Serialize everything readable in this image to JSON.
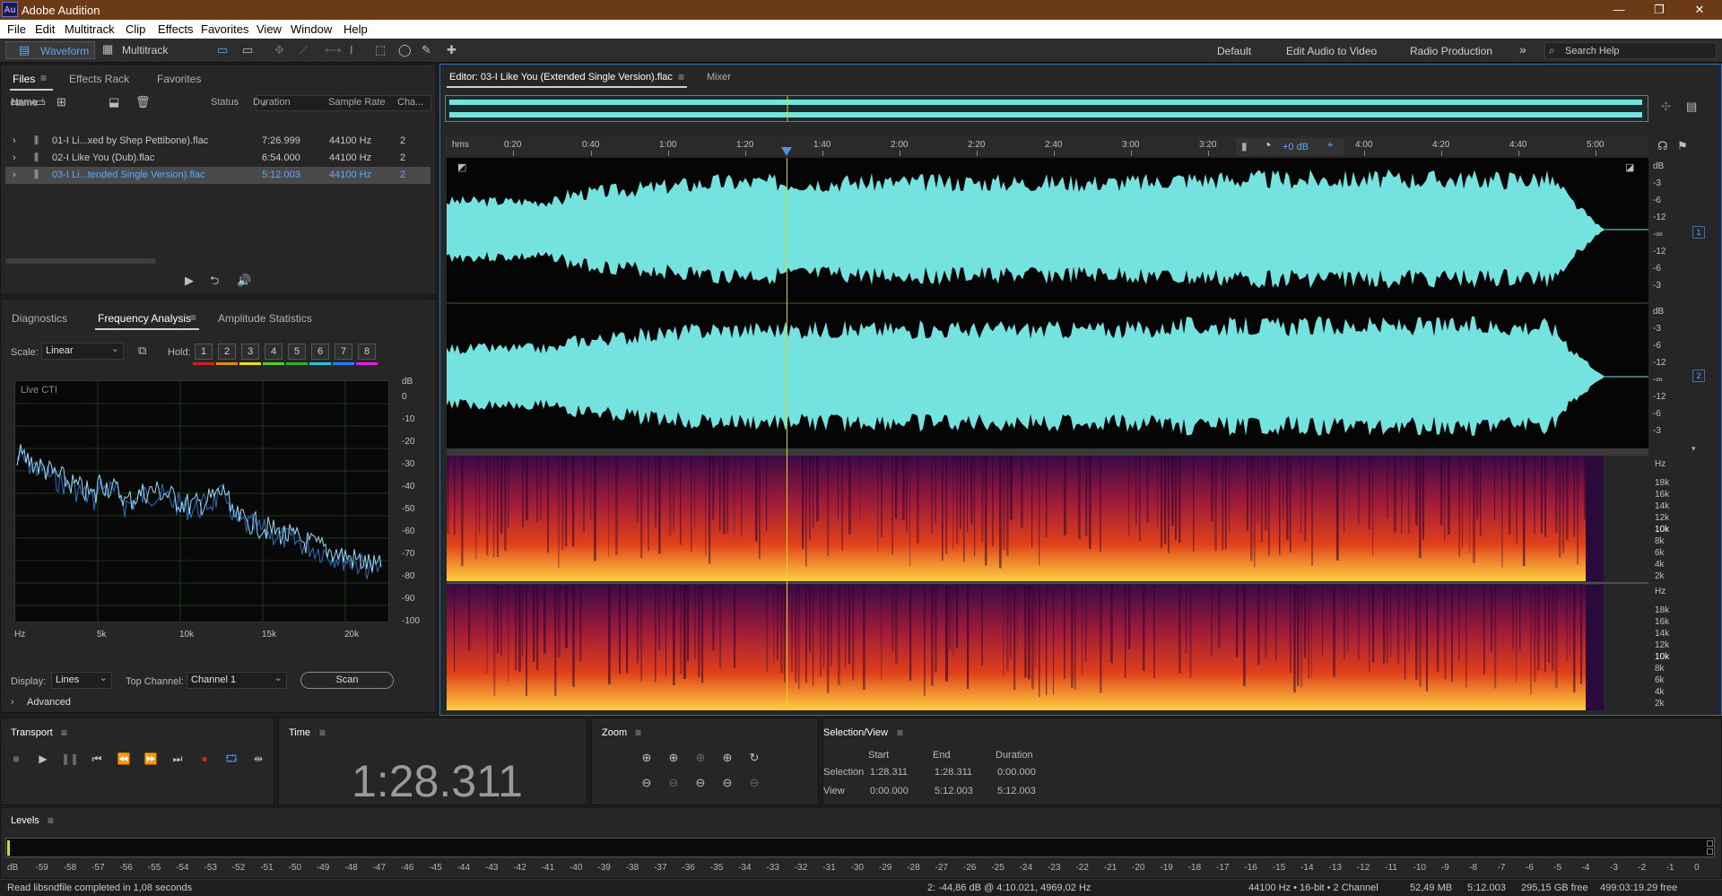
{
  "app": {
    "title": "Adobe Audition",
    "logo": "Au"
  },
  "menu": [
    "File",
    "Edit",
    "Multitrack",
    "Clip",
    "Effects",
    "Favorites",
    "View",
    "Window",
    "Help"
  ],
  "toolbar": {
    "waveform": "Waveform",
    "multitrack": "Multitrack",
    "workspaces": [
      "Default",
      "Edit Audio to Video",
      "Radio Production"
    ],
    "search_placeholder": "Search Help"
  },
  "files_panel": {
    "tabs": [
      "Files",
      "Effects Rack",
      "Favorites"
    ],
    "columns": [
      "Name",
      "Status",
      "Duration",
      "Sample Rate",
      "Cha..."
    ],
    "rows": [
      {
        "name": "01-I Li...xed by Shep Pettibone).flac",
        "status": "",
        "duration": "7:26.999",
        "rate": "44100 Hz",
        "ch": "2"
      },
      {
        "name": "02-I Like You (Dub).flac",
        "status": "",
        "duration": "6:54.000",
        "rate": "44100 Hz",
        "ch": "2"
      },
      {
        "name": "03-I Li...tended Single Version).flac",
        "status": "",
        "duration": "5:12.003",
        "rate": "44100 Hz",
        "ch": "2"
      }
    ]
  },
  "analysis": {
    "tabs": [
      "Diagnostics",
      "Frequency Analysis",
      "Amplitude Statistics"
    ],
    "scale_label": "Scale:",
    "scale_value": "Linear",
    "hold_label": "Hold:",
    "holds": [
      "1",
      "2",
      "3",
      "4",
      "5",
      "6",
      "7",
      "8"
    ],
    "hold_colors": [
      "#d02020",
      "#e08a10",
      "#e6e020",
      "#50d020",
      "#30b030",
      "#20c8d8",
      "#2080ff",
      "#e020e0"
    ],
    "live": "Live CTI",
    "db_unit": "dB",
    "db_ticks": [
      "0",
      "-10",
      "-20",
      "-30",
      "-40",
      "-50",
      "-60",
      "-70",
      "-80",
      "-90",
      "-100"
    ],
    "freq_ticks": [
      "Hz",
      "5k",
      "10k",
      "15k",
      "20k"
    ],
    "display_label": "Display:",
    "display_value": "Lines",
    "top_channel_label": "Top Channel:",
    "top_channel_value": "Channel 1",
    "scan": "Scan",
    "advanced": "Advanced"
  },
  "editor": {
    "tab": "Editor: 03-I Like You (Extended Single Version).flac",
    "mixer": "Mixer",
    "ruler": [
      "hms",
      "0:20",
      "0:40",
      "1:00",
      "1:20",
      "1:40",
      "2:00",
      "2:20",
      "2:40",
      "3:00",
      "3:20",
      "4:00",
      "4:20",
      "4:40",
      "5:00"
    ],
    "hud": "+0 dB",
    "db_scale": [
      "dB",
      "-3",
      "-6",
      "-12",
      "-∞",
      "-12",
      "-6",
      "-3"
    ],
    "ch1": "1",
    "ch2": "2",
    "hz_scale": [
      "Hz",
      "18k",
      "16k",
      "14k",
      "12k",
      "10k",
      "8k",
      "6k",
      "4k",
      "2k"
    ],
    "waveform_color": "#74e3e0",
    "playhead_color": "#d8d820"
  },
  "transport": {
    "title": "Transport"
  },
  "time": {
    "title": "Time",
    "value": "1:28.311"
  },
  "zoom": {
    "title": "Zoom"
  },
  "selection": {
    "title": "Selection/View",
    "headers": [
      "Start",
      "End",
      "Duration"
    ],
    "selection": {
      "label": "Selection",
      "start": "1:28.311",
      "end": "1:28.311",
      "duration": "0:00.000"
    },
    "view": {
      "label": "View",
      "start": "0:00.000",
      "end": "5:12.003",
      "duration": "5:12.003"
    }
  },
  "levels": {
    "title": "Levels",
    "scale": [
      "dB",
      "-59",
      "-58",
      "-57",
      "-56",
      "-55",
      "-54",
      "-53",
      "-52",
      "-51",
      "-50",
      "-49",
      "-48",
      "-47",
      "-46",
      "-45",
      "-44",
      "-43",
      "-42",
      "-41",
      "-40",
      "-39",
      "-38",
      "-37",
      "-36",
      "-35",
      "-34",
      "-33",
      "-32",
      "-31",
      "-30",
      "-29",
      "-28",
      "-27",
      "-26",
      "-25",
      "-24",
      "-23",
      "-22",
      "-21",
      "-20",
      "-19",
      "-18",
      "-17",
      "-16",
      "-15",
      "-14",
      "-13",
      "-12",
      "-11",
      "-10",
      "-9",
      "-8",
      "-7",
      "-6",
      "-5",
      "-4",
      "-3",
      "-2",
      "-1",
      "0"
    ]
  },
  "status": {
    "message": "Read libsndfile completed in 1,08 seconds",
    "cursor": "2: -44,86 dB @ 4:10.021, 4969,02 Hz",
    "format": "44100 Hz • 16-bit • 2 Channel",
    "size": "52,49 MB",
    "duration": "5:12.003",
    "disk": "295,15 GB free",
    "free_time": "499:03:19.29 free"
  }
}
